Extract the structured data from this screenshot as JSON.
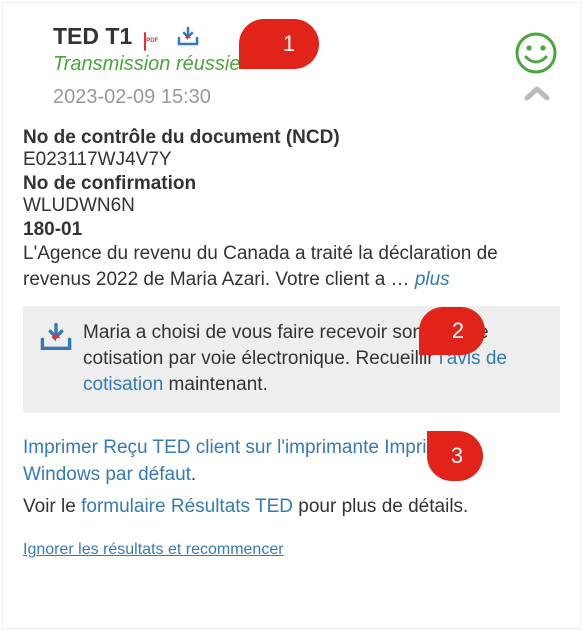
{
  "header": {
    "title": "TED T1",
    "status": "Transmission réussie",
    "timestamp": "2023-02-09 15:30"
  },
  "ncd": {
    "label": "No de contrôle du document (NCD)",
    "value": "E023117WJ4V7Y"
  },
  "conf": {
    "label": "No de confirmation",
    "value": "WLUDWN6N"
  },
  "code": "180-01",
  "body_before": "L'Agence du revenu du Canada a traité la déclaration de revenus 2022 de Maria Azari. Votre client a",
  "body_ellipsis": "…  ",
  "more": "plus",
  "callout": {
    "before": "Maria a choisi de vous faire recevoir son avis de cotisation par voie électronique. Recueillir ",
    "link": "l'avis de cotisation",
    "after": " maintenant."
  },
  "print": {
    "before": "Imprimer Reçu TED client sur l'imprimante Imprimante Windows par défaut",
    "after": "."
  },
  "seeform": {
    "before": "Voir le ",
    "link": "formulaire Résultats TED",
    "after": " pour plus de détails."
  },
  "ignore": "Ignorer les résultats et recommencer",
  "markers": {
    "m1": "1",
    "m2": "2",
    "m3": "3"
  }
}
